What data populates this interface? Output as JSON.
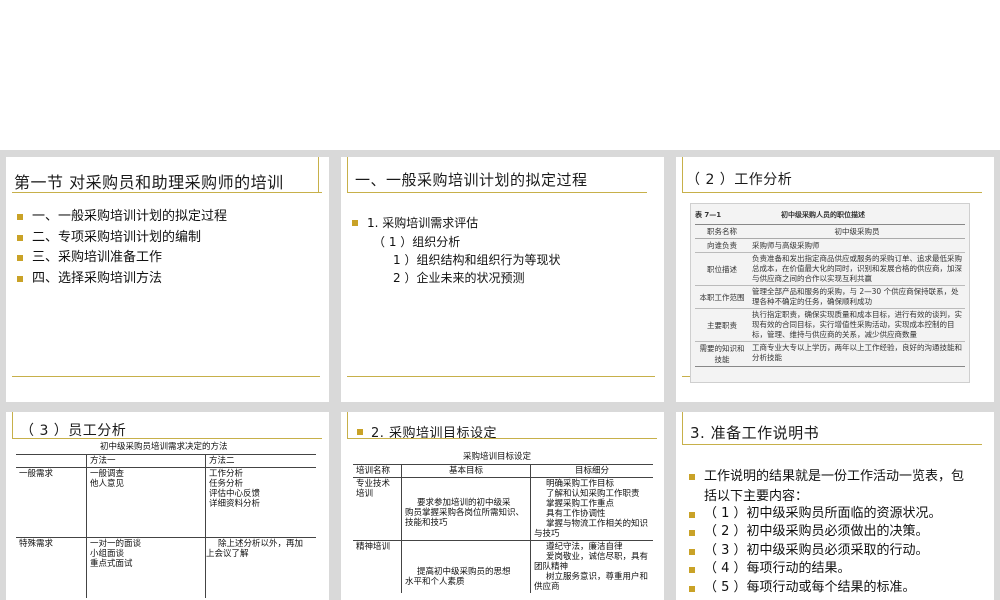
{
  "colors": {
    "accent": "#c9a227",
    "line": "#c7b04a",
    "background": "#d9d9d9"
  },
  "slide1": {
    "title": "第一节  对采购员和助理采购师的培训",
    "bullets": [
      "一、一般采购培训计划的拟定过程",
      "二、专项采购培训计划的编制",
      "三、采购培训准备工作",
      "四、选择采购培训方法"
    ]
  },
  "slide2": {
    "title": "一、一般采购培训计划的拟定过程",
    "bullet": "1. 采购培训需求评估",
    "sub1": "（ 1 ）组织分析",
    "sub2": "1 ）组织结构和组织行为等现状",
    "sub3": "2 ）企业未来的状况预测"
  },
  "slide3": {
    "title": "（ 2 ）工作分析",
    "table_label": "表 7—1",
    "table_title": "初中级采购人员的职位描述",
    "header": [
      "职务名称",
      "初中级采购员"
    ],
    "rows": [
      [
        "向谁负责",
        "采购师与高级采购师"
      ],
      [
        "职位描述",
        "负责准备和发出指定商品供应或服务的采购订单、追求最低采购总成本，在价值最大化的同时，识别和发展合格的供应商，加深与供应商之间的合作以实现互利共赢"
      ],
      [
        "本职工作范围",
        "管理全部产品和服务的采购，与 2—30 个供应商保持联系，处理各种不确定的任务，确保顺利成功"
      ],
      [
        "主要职责",
        "执行指定职责，确保实现质量和成本目标，进行有效的谈判，实现有效的合同目标，实行增值性采购活动，实现成本控制的目标，管理、维持与供应商的关系，减少供应商数量"
      ],
      [
        "需要的知识和技能",
        "工商专业大专以上学历，两年以上工作经验，良好的沟通技能和分析技能"
      ]
    ]
  },
  "slide4": {
    "title": "（ 3 ）员工分析",
    "caption": "初中级采购员培训需求决定的方法",
    "col_headers": [
      "方法一",
      "方法二"
    ],
    "rows": [
      {
        "label": "一般需求",
        "m1": [
          "一般调查",
          "他人意见"
        ],
        "m2": [
          "工作分析",
          "任务分析",
          "评估中心反馈",
          "详细资料分析"
        ]
      },
      {
        "label": "特殊需求",
        "m1": [
          "一对一的面谈",
          "小组面谈",
          "重点式面试"
        ],
        "m2": [
          "除上述分析以外，再加",
          "上会议了解"
        ]
      }
    ]
  },
  "slide5": {
    "title": "2. 采购培训目标设定",
    "caption": "采购培训目标设定",
    "headers": [
      "培训名称",
      "基本目标",
      "目标细分"
    ],
    "rows": [
      {
        "name": [
          "专业技术",
          "培训"
        ],
        "goal": [
          "要求参加培训的初中级采",
          "购员掌握采购各岗位所需知识、",
          "技能和技巧"
        ],
        "detail": [
          "明确采购工作目标",
          "了解和认知采购工作职责",
          "掌握采购工作重点",
          "具有工作协调性",
          "掌握与物流工作相关的知识",
          "与技巧"
        ]
      },
      {
        "name": [
          "精神培训"
        ],
        "goal": [
          "提高初中级采购员的思想",
          "水平和个人素质"
        ],
        "detail": [
          "遵纪守法，廉洁自律",
          "爱岗敬业，诚信尽职，具有",
          "团队精神",
          "树立服务意识，尊重用户和",
          "供应商"
        ]
      }
    ]
  },
  "slide6": {
    "title": "3. 准备工作说明书",
    "bullets": [
      "工作说明的结果就是一份工作活动一览表，包",
      "（ 1 ）初中级采购员所面临的资源状况。",
      "（ 2 ）初中级采购员必须做出的决策。",
      "（ 3 ）初中级采购员必须采取的行动。",
      "（ 4 ）每项行动的结果。",
      "（ 5 ）每项行动或每个结果的标准。"
    ],
    "continuation": "括以下主要内容："
  }
}
